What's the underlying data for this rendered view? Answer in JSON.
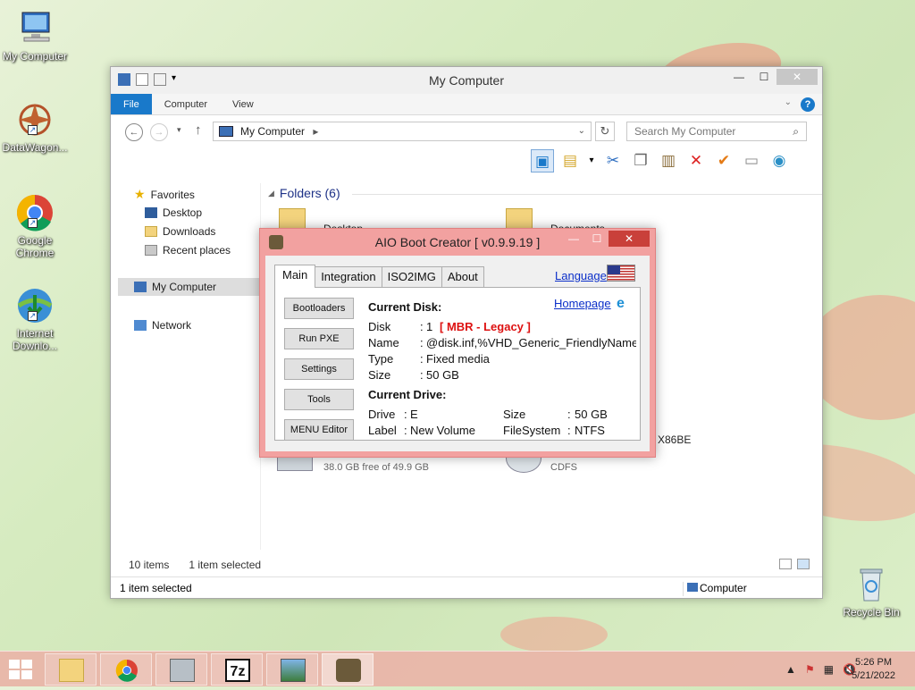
{
  "desktop": {
    "icons": [
      {
        "label": "My Computer",
        "icon": "my-computer-icon"
      },
      {
        "label": "DataWagon...",
        "icon": "datawagon-icon"
      },
      {
        "label": "Google Chrome",
        "icon": "chrome-icon"
      },
      {
        "label": "Internet Downlo...",
        "icon": "idm-icon"
      },
      {
        "label": "Recycle Bin",
        "icon": "recycle-bin-icon"
      }
    ]
  },
  "explorer": {
    "title": "My Computer",
    "ribbon_tabs": [
      "File",
      "Computer",
      "View"
    ],
    "address": "My Computer",
    "search_placeholder": "Search My Computer",
    "nav": {
      "favorites": "Favorites",
      "desktop": "Desktop",
      "downloads": "Downloads",
      "recent": "Recent places",
      "mycomputer": "My Computer",
      "network": "Network"
    },
    "folders_header": "Folders (6)",
    "folders": [
      "Desktop",
      "Documents"
    ],
    "drive_c_free": "38.0 GB free of 49.9 GB",
    "drive_x86": "X86BE",
    "drive_cdfs": "CDFS",
    "status_items": "10 items",
    "status_selected": "1 item selected",
    "status_bottom_left": "1 item selected",
    "status_bottom_right": "Computer"
  },
  "dialog": {
    "title": "AIO Boot Creator [ v0.9.9.19 ]",
    "tabs": [
      "Main",
      "Integration",
      "ISO2IMG",
      "About"
    ],
    "language": "Language",
    "homepage": "Homepage",
    "buttons": [
      "Bootloaders",
      "Run PXE",
      "Settings",
      "Tools",
      "MENU Editor"
    ],
    "current_disk_label": "Current Disk:",
    "disk": {
      "disk_label": "Disk",
      "disk_value": "1",
      "disk_mode": "[ MBR - Legacy ]",
      "name_label": "Name",
      "name_value": "@disk.inf,%VHD_Generic_FriendlyName",
      "type_label": "Type",
      "type_value": "Fixed media",
      "size_label": "Size",
      "size_value": "50 GB"
    },
    "current_drive_label": "Current Drive:",
    "drive": {
      "drive_label": "Drive",
      "drive_value": "E",
      "label_label": "Label",
      "label_value": "New Volume",
      "size_label": "Size",
      "size_value": "50 GB",
      "fs_label": "FileSystem",
      "fs_value": "NTFS"
    }
  },
  "taskbar": {
    "items": [
      "file-explorer-icon",
      "chrome-icon",
      "drive-tool-icon",
      "7zip-icon",
      "image-viewer-icon",
      "aio-boot-icon"
    ],
    "sevenzip_label": "7z",
    "time": "5:26 PM",
    "date": "5/21/2022"
  },
  "colors": {
    "accent": "#1979ca",
    "dialog_frame": "#f2a1a0",
    "link": "#0b2fc9",
    "warning_red": "#dd1111"
  }
}
